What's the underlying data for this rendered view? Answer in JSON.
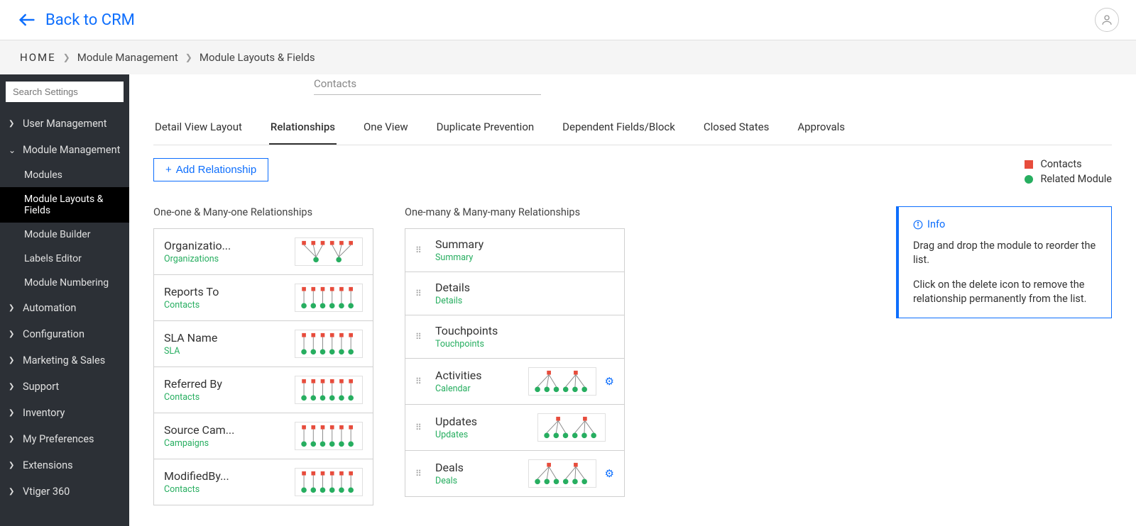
{
  "header": {
    "back_label": "Back to CRM"
  },
  "breadcrumb": {
    "home": "HOME",
    "crumb1": "Module Management",
    "crumb2": "Module Layouts & Fields"
  },
  "sidebar": {
    "search_placeholder": "Search Settings",
    "items": [
      {
        "label": "User Management",
        "expanded": false
      },
      {
        "label": "Module Management",
        "expanded": true,
        "children": [
          {
            "label": "Modules",
            "active": false
          },
          {
            "label": "Module Layouts & Fields",
            "active": true
          },
          {
            "label": "Module Builder",
            "active": false
          },
          {
            "label": "Labels Editor",
            "active": false
          },
          {
            "label": "Module Numbering",
            "active": false
          }
        ]
      },
      {
        "label": "Automation",
        "expanded": false
      },
      {
        "label": "Configuration",
        "expanded": false
      },
      {
        "label": "Marketing & Sales",
        "expanded": false
      },
      {
        "label": "Support",
        "expanded": false
      },
      {
        "label": "Inventory",
        "expanded": false
      },
      {
        "label": "My Preferences",
        "expanded": false
      },
      {
        "label": "Extensions",
        "expanded": false
      },
      {
        "label": "Vtiger 360",
        "expanded": false
      }
    ]
  },
  "dropdown_value": "Contacts",
  "tabs": [
    "Detail View Layout",
    "Relationships",
    "One View",
    "Duplicate Prevention",
    "Dependent Fields/Block",
    "Closed States",
    "Approvals"
  ],
  "active_tab_index": 1,
  "add_relationship_label": "Add Relationship",
  "legend": {
    "contacts": "Contacts",
    "related": "Related Module"
  },
  "left_col_title": "One-one & Many-one Relationships",
  "right_col_title": "One-many & Many-many Relationships",
  "left_items": [
    {
      "title": "Organizatio...",
      "sub": "Organizations",
      "diagram": "many-one"
    },
    {
      "title": "Reports To",
      "sub": "Contacts",
      "diagram": "one-many"
    },
    {
      "title": "SLA Name",
      "sub": "SLA",
      "diagram": "one-many"
    },
    {
      "title": "Referred By",
      "sub": "Contacts",
      "diagram": "one-many"
    },
    {
      "title": "Source Cam...",
      "sub": "Campaigns",
      "diagram": "one-many"
    },
    {
      "title": "ModifiedBy...",
      "sub": "Contacts",
      "diagram": "one-many"
    }
  ],
  "right_items": [
    {
      "title": "Summary",
      "sub": "Summary",
      "diagram": null,
      "gear": false
    },
    {
      "title": "Details",
      "sub": "Details",
      "diagram": null,
      "gear": false
    },
    {
      "title": "Touchpoints",
      "sub": "Touchpoints",
      "diagram": null,
      "gear": false
    },
    {
      "title": "Activities",
      "sub": "Calendar",
      "diagram": "one-many-tree",
      "gear": true
    },
    {
      "title": "Updates",
      "sub": "Updates",
      "diagram": "one-many-tree",
      "gear": false
    },
    {
      "title": "Deals",
      "sub": "Deals",
      "diagram": "one-many-tree",
      "gear": true
    }
  ],
  "info": {
    "title": "Info",
    "p1": "Drag and drop the module to reorder the list.",
    "p2": "Click on the delete icon to remove the relationship permanently from the list."
  }
}
